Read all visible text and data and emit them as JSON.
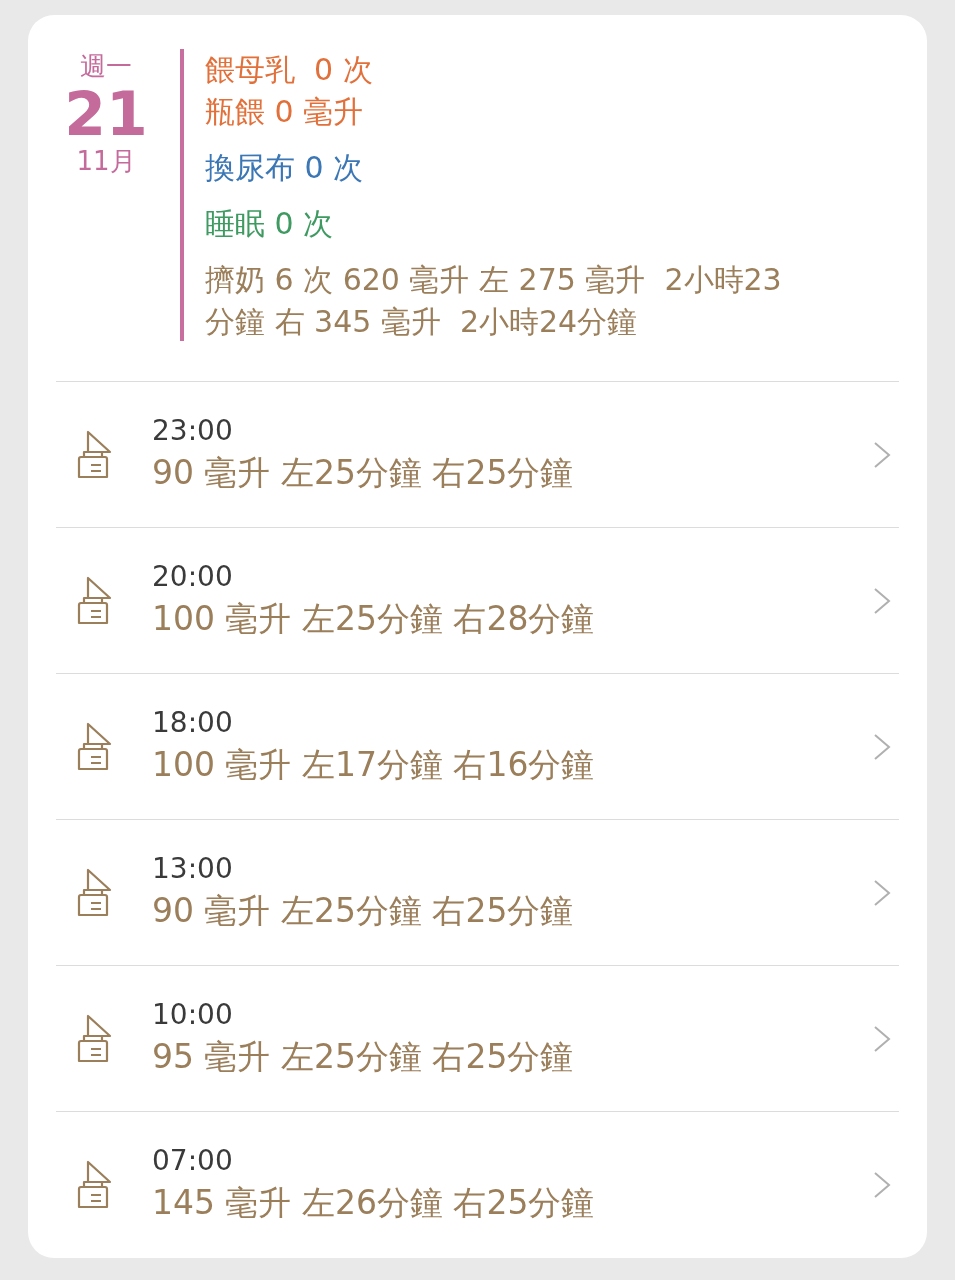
{
  "date": {
    "weekday": "週一",
    "day": "21",
    "month": "11月"
  },
  "summary": [
    {
      "color": "#e2703a",
      "lines": [
        "餵母乳  0 次",
        "瓶餵 0 毫升"
      ]
    },
    {
      "color": "#3b76b5",
      "lines": [
        "換尿布 0 次"
      ]
    },
    {
      "color": "#3f9a62",
      "lines": [
        "睡眠 0 次"
      ]
    },
    {
      "color": "#9b7e5a",
      "lines": [
        "擠奶 6 次 620 毫升 左 275 毫升  2小時23",
        "分鐘 右 345 毫升  2小時24分鐘"
      ]
    }
  ],
  "entries": [
    {
      "time": "23:00",
      "detail": "90 毫升 左25分鐘 右25分鐘"
    },
    {
      "time": "20:00",
      "detail": "100 毫升 左25分鐘 右28分鐘"
    },
    {
      "time": "18:00",
      "detail": "100 毫升 左17分鐘 右16分鐘"
    },
    {
      "time": "13:00",
      "detail": "90 毫升 左25分鐘 右25分鐘"
    },
    {
      "time": "10:00",
      "detail": "95 毫升 左25分鐘 右25分鐘"
    },
    {
      "time": "07:00",
      "detail": "145 毫升 左26分鐘 右25分鐘"
    }
  ]
}
